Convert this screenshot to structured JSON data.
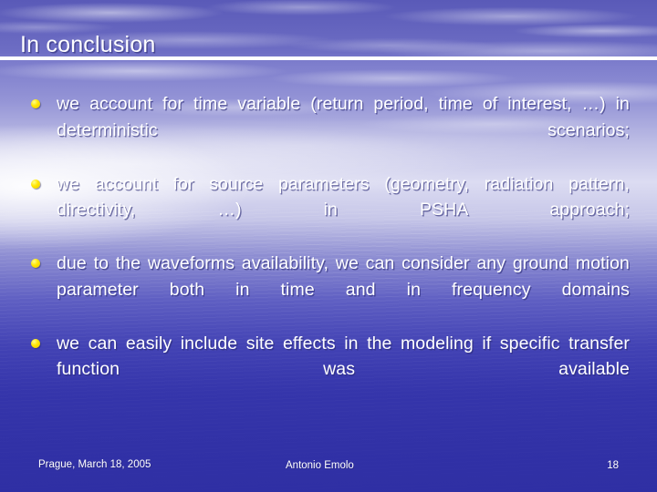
{
  "slide": {
    "title": "In conclusion",
    "theme": {
      "background_name": "sky-and-sea-gradient",
      "accent_bullet_color": "#ffe500",
      "text_color": "#ffffff",
      "deep_blue": "#3030a6",
      "cloud_blue": "#6464be",
      "divider_color": "#ffffff"
    },
    "bullets": [
      {
        "marker": "yellow-dot",
        "text": "we account for time variable (return period, time of interest, …) in deterministic scenarios;"
      },
      {
        "marker": "yellow-dot",
        "text": "we account for source parameters (geometry, radiation pattern, directivity, …) in PSHA approach;"
      },
      {
        "marker": "yellow-dot",
        "text": "due to the waveforms availability, we can consider any ground motion parameter both in time and in frequency domains"
      },
      {
        "marker": "yellow-dot",
        "text": "we can easily include site effects in the modeling if specific transfer function was available"
      }
    ],
    "footer": {
      "date": "Prague, March 18, 2005",
      "author": "Antonio Emolo",
      "page_number": "18"
    }
  }
}
